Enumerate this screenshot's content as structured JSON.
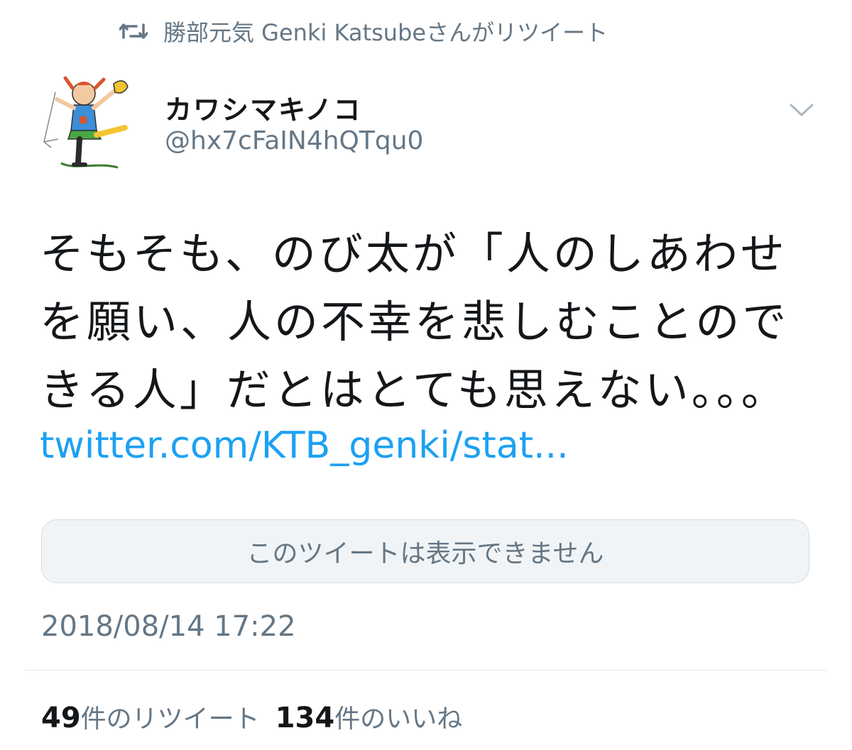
{
  "retweet_context": {
    "icon": "retweet-icon",
    "text": "勝部元気 Genki Katsubeさんがリツイート"
  },
  "author": {
    "display_name": "カワシマキノコ",
    "handle": "@hx7cFaIN4hQTqu0",
    "avatar": "avatar-illustration"
  },
  "menu": {
    "icon": "chevron-down-icon"
  },
  "tweet": {
    "text": "そもそも、のび太が「人のしあわせを願い、人の不幸を悲しむことのできる人」だとはとても思えない。。。",
    "link": "twitter.com/KTB_genki/stat...",
    "quoted_unavailable": "このツイートは表示できません",
    "timestamp": "2018/08/14 17:22"
  },
  "stats": {
    "retweets_count": "49",
    "retweets_label": "件のリツイート",
    "likes_count": "134",
    "likes_label": "件のいいね"
  },
  "colors": {
    "link": "#1da1f2",
    "secondary_text": "#657786",
    "primary_text": "#14171a",
    "card_bg": "#f1f4f6"
  }
}
